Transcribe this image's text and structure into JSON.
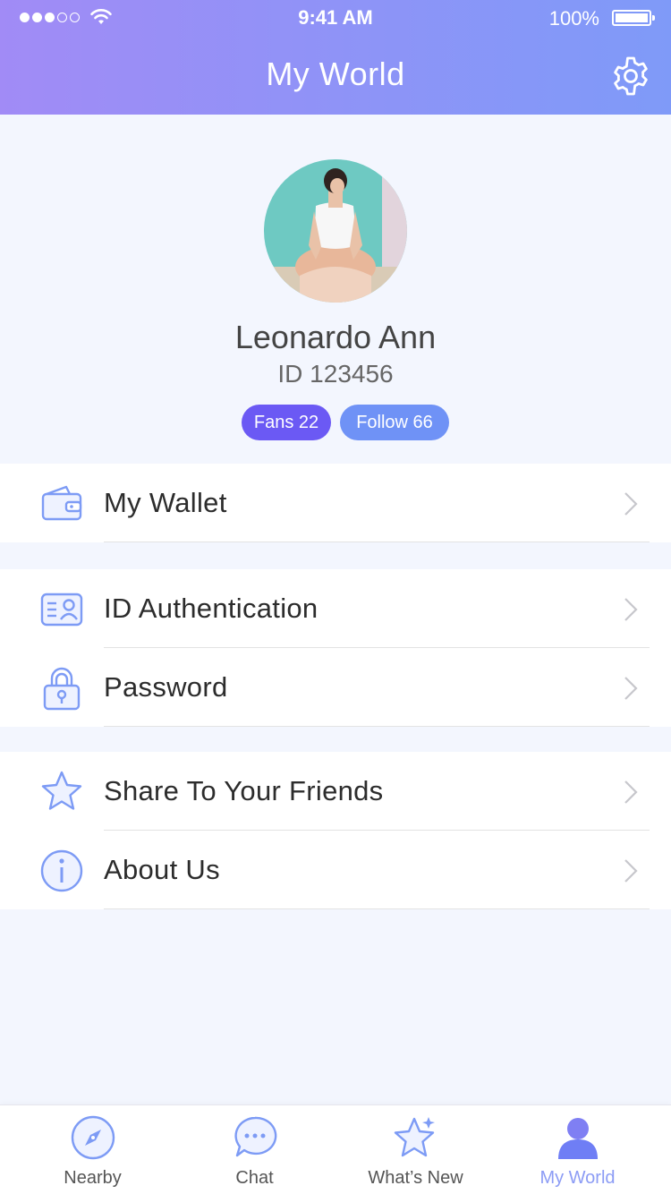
{
  "status_bar": {
    "time": "9:41 AM",
    "battery": "100%"
  },
  "header": {
    "title": "My World"
  },
  "profile": {
    "name": "Leonardo Ann",
    "id": "ID 123456",
    "fans": "Fans 22",
    "follow": "Follow 66"
  },
  "menu": {
    "wallet": "My Wallet",
    "id_auth": "ID Authentication",
    "password": "Password",
    "share": "Share To Your Friends",
    "about": "About Us"
  },
  "tabs": [
    {
      "label": "Nearby"
    },
    {
      "label": "Chat"
    },
    {
      "label": "What’s New"
    },
    {
      "label": "My World"
    }
  ],
  "colors": {
    "accent": "#6b59f4",
    "accent_light": "#6f92f6",
    "icon_blue": "#7d9bf5",
    "background": "#f3f6fe"
  }
}
